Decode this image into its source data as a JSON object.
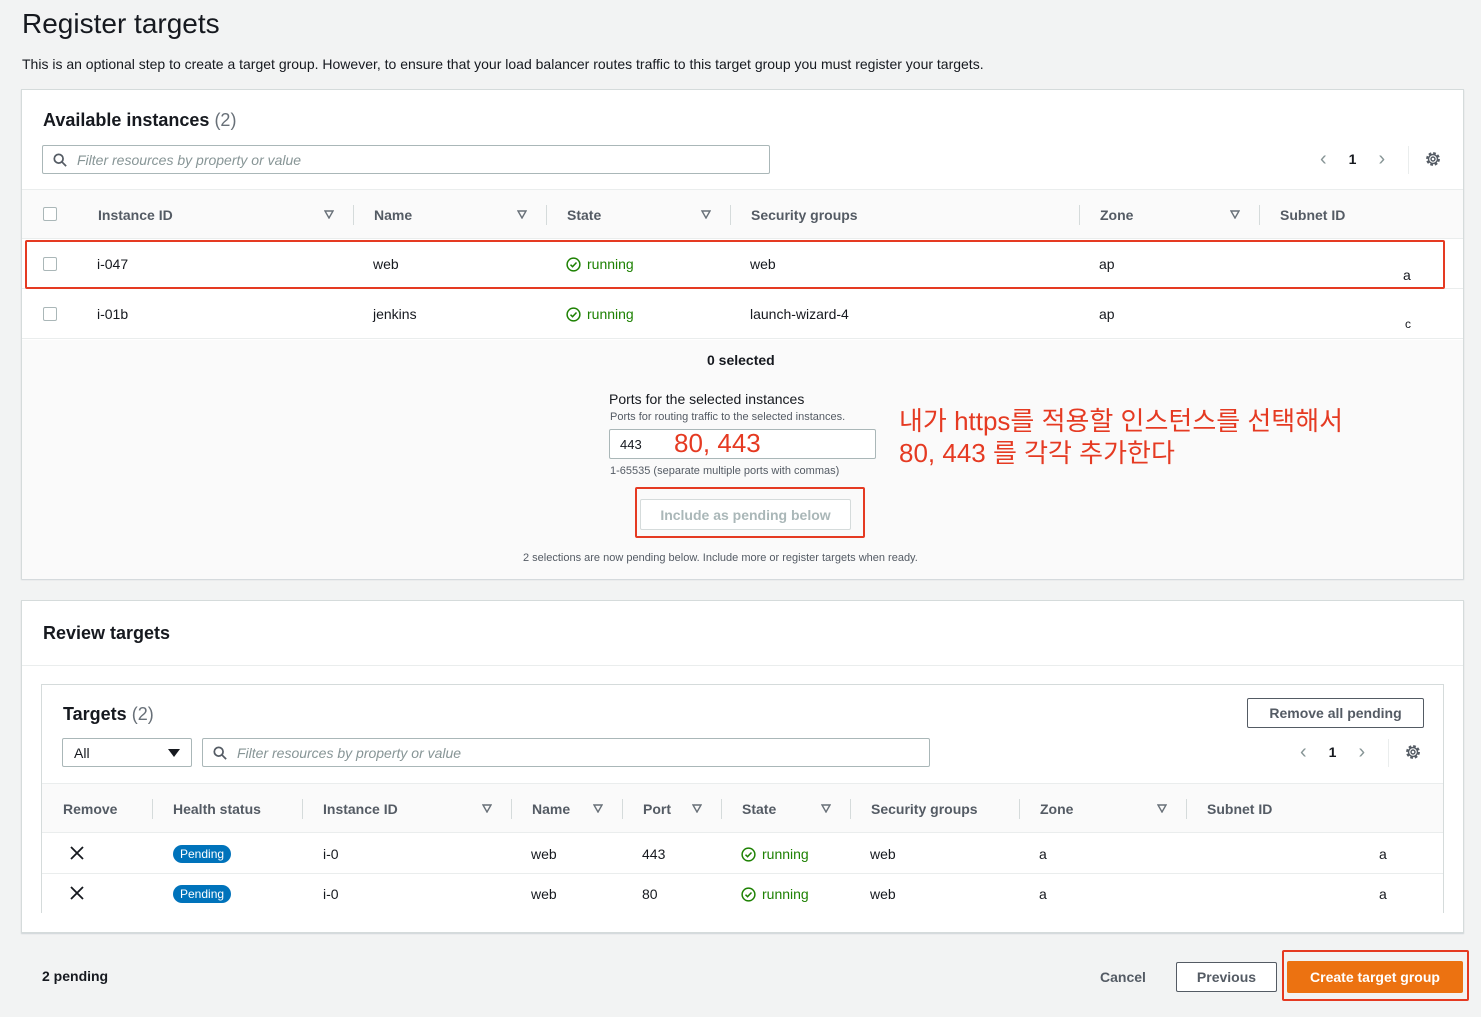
{
  "page": {
    "title": "Register targets",
    "description": "This is an optional step to create a target group. However, to ensure that your load balancer routes traffic to this target group you must register your targets."
  },
  "available": {
    "title": "Available instances",
    "count": "(2)",
    "filter_placeholder": "Filter resources by property or value",
    "page": "1",
    "columns": [
      "Instance ID",
      "Name",
      "State",
      "Security groups",
      "Zone",
      "Subnet ID"
    ],
    "rows": [
      {
        "instance_id": "i-047",
        "name": "web",
        "state": "running",
        "security_groups": "web",
        "zone": "ap",
        "subnet": "a"
      },
      {
        "instance_id": "i-01b",
        "name": "jenkins",
        "state": "running",
        "security_groups": "launch-wizard-4",
        "zone": "ap",
        "subnet": "c"
      }
    ],
    "selected_text": "0 selected",
    "ports_label": "Ports for the selected instances",
    "ports_hint": "Ports for routing traffic to the selected instances.",
    "ports_value": "443",
    "ports_constraint": "1-65535 (separate multiple ports with commas)",
    "include_button": "Include as pending below",
    "pending_note": "2 selections are now pending below. Include more or register targets when ready."
  },
  "annotations": {
    "ports_overlay": "80, 443",
    "note_line1": "내가 https를 적용할 인스턴스를 선택해서",
    "note_line2": "80, 443 를 각각 추가한다"
  },
  "review": {
    "title": "Review targets",
    "targets_title": "Targets",
    "targets_count": "(2)",
    "remove_all_button": "Remove all pending",
    "select_value": "All",
    "filter_placeholder": "Filter resources by property or value",
    "page": "1",
    "columns": [
      "Remove",
      "Health status",
      "Instance ID",
      "Name",
      "Port",
      "State",
      "Security groups",
      "Zone",
      "Subnet ID"
    ],
    "rows": [
      {
        "health": "Pending",
        "instance_id": "i-0",
        "name": "web",
        "port": "443",
        "state": "running",
        "security_groups": "web",
        "zone": "a",
        "subnet": "a"
      },
      {
        "health": "Pending",
        "instance_id": "i-0",
        "name": "web",
        "port": "80",
        "state": "running",
        "security_groups": "web",
        "zone": "a",
        "subnet": "a"
      }
    ]
  },
  "footer": {
    "pending_count": "2 pending",
    "cancel": "Cancel",
    "previous": "Previous",
    "create": "Create target group"
  },
  "colors": {
    "primary": "#ec7211",
    "annotation": "#e53a22",
    "running": "#1d8102",
    "badge": "#0073bb"
  }
}
